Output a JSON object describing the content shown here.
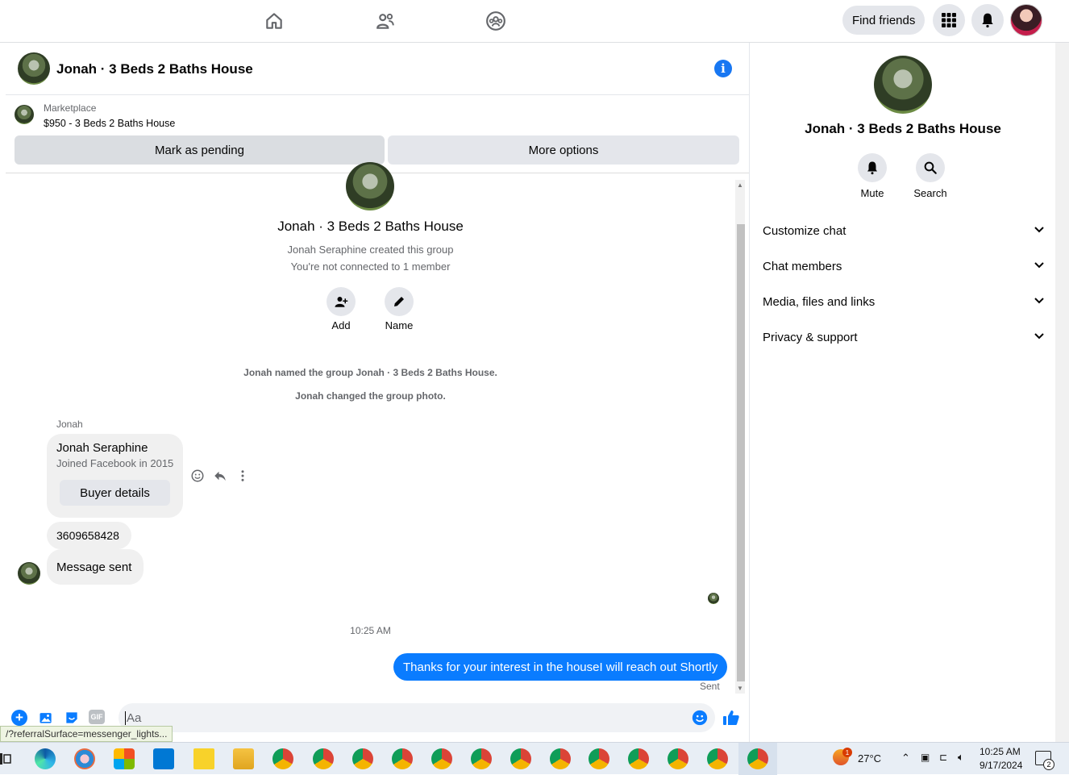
{
  "top_nav": {
    "find_friends_label": "Find friends"
  },
  "chat": {
    "title": "Jonah · 3 Beds 2 Baths House",
    "marketplace": {
      "label": "Marketplace",
      "listing": "$950 - 3 Beds 2 Baths House",
      "mark_pending_label": "Mark as pending",
      "more_options_label": "More options"
    },
    "intro": {
      "group_name": "Jonah · 3 Beds 2 Baths House",
      "created_by": "Jonah Seraphine created this group",
      "connection": "You're not connected to 1 member",
      "add_label": "Add",
      "name_label": "Name"
    },
    "events": [
      "Jonah named the group Jonah · 3 Beds 2 Baths House.",
      "Jonah changed the group photo."
    ],
    "sender_label": "Jonah",
    "buyer_card": {
      "name": "Jonah Seraphine",
      "joined": "Joined Facebook in 2015",
      "button": "Buyer details"
    },
    "messages": {
      "phone": "3609658428",
      "message_sent": "Message sent",
      "timestamp": "10:25 AM",
      "outgoing": "Thanks for your interest in the houseI will reach out Shortly",
      "status": "Sent"
    },
    "composer_placeholder": "Aa",
    "url_tooltip": "/?referralSurface=messenger_lights..."
  },
  "sidebar": {
    "title": "Jonah · 3 Beds 2 Baths House",
    "mute_label": "Mute",
    "search_label": "Search",
    "sections": [
      "Customize chat",
      "Chat members",
      "Media, files and links",
      "Privacy & support"
    ]
  },
  "taskbar": {
    "weather_temp": "27°C",
    "weather_badge": "1",
    "time": "10:25 AM",
    "date": "9/17/2024",
    "notification_count": "2"
  },
  "colors": {
    "accent": "#0a7cff",
    "brand_blue": "#1877f2",
    "button_gray": "#e4e6eb"
  }
}
